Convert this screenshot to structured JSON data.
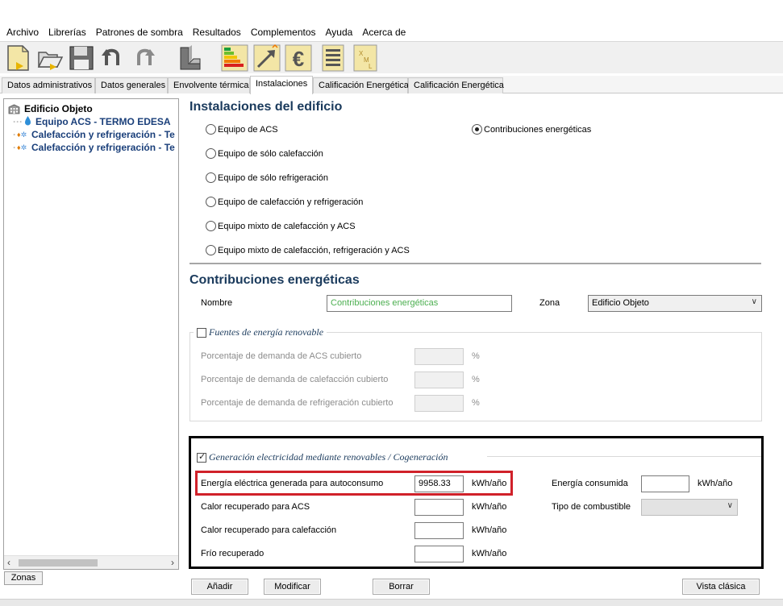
{
  "menu": [
    "Archivo",
    "Librerías",
    "Patrones de sombra",
    "Resultados",
    "Complementos",
    "Ayuda",
    "Acerca de"
  ],
  "toolbar": {
    "icons": [
      "new-file-icon",
      "open-folder-icon",
      "save-disk-icon",
      "undo-icon",
      "redo-icon",
      "building-3d-icon",
      "energy-rating-icon",
      "arrow-chart-icon",
      "euro-icon",
      "report-list-icon",
      "xml-file-icon"
    ],
    "colors": {
      "rating_green": "#1a9e3a",
      "rating_yellow": "#f2c500",
      "rating_orange": "#f07a00",
      "rating_red": "#d8201e",
      "file_yellow": "#f3e6a6"
    }
  },
  "tabs": [
    "Datos administrativos",
    "Datos generales",
    "Envolvente térmica",
    "Instalaciones",
    "Calificación Energética",
    "Calificación Energética"
  ],
  "active_tab": "Instalaciones",
  "tree": {
    "root": "Edificio Objeto",
    "children": [
      "Equipo ACS - TERMO EDESA",
      "Calefacción y refrigeración - Te",
      "Calefacción y refrigeración - Te"
    ],
    "zonas_button": "Zonas"
  },
  "instalaciones": {
    "title": "Instalaciones del edificio",
    "options": [
      "Equipo de ACS",
      "Equipo de sólo calefacción",
      "Equipo de sólo refrigeración",
      "Equipo de calefacción y refrigeración",
      "Equipo mixto de calefacción y ACS",
      "Equipo mixto de calefacción, refrigeración y ACS"
    ],
    "selected_option": "Contribuciones energéticas",
    "right_option": "Contribuciones energéticas"
  },
  "contribuciones": {
    "title": "Contribuciones energéticas",
    "nombre_label": "Nombre",
    "nombre_value": "Contribuciones energéticas",
    "zona_label": "Zona",
    "zona_value": "Edificio Objeto"
  },
  "renovables": {
    "title": "Fuentes de energía renovable",
    "checked": false,
    "rows": [
      {
        "label": "Porcentaje de demanda de ACS cubierto",
        "value": "",
        "unit": "%"
      },
      {
        "label": "Porcentaje de demanda de calefacción cubierto",
        "value": "",
        "unit": "%"
      },
      {
        "label": "Porcentaje de demanda de refrigeración cubierto",
        "value": "",
        "unit": "%"
      }
    ]
  },
  "generacion": {
    "title": "Generación electricidad mediante renovables / Cogeneración",
    "checked": true,
    "rows": [
      {
        "label": "Energía eléctrica generada para autoconsumo",
        "value": "9958.33",
        "unit": "kWh/año"
      },
      {
        "label": "Calor recuperado para ACS",
        "value": "",
        "unit": "kWh/año"
      },
      {
        "label": "Calor recuperado para calefacción",
        "value": "",
        "unit": "kWh/año"
      },
      {
        "label": "Frío recuperado",
        "value": "",
        "unit": "kWh/año"
      }
    ],
    "energia_consumida_label": "Energía consumida",
    "energia_consumida_value": "",
    "energia_consumida_unit": "kWh/año",
    "tipo_combustible_label": "Tipo de combustible",
    "tipo_combustible_value": ""
  },
  "buttons": {
    "add": "Añadir",
    "modify": "Modificar",
    "delete": "Borrar",
    "classic_view": "Vista clásica"
  },
  "highlight_colors": {
    "outer_box": "#000000",
    "focus_box": "#d0212a"
  }
}
